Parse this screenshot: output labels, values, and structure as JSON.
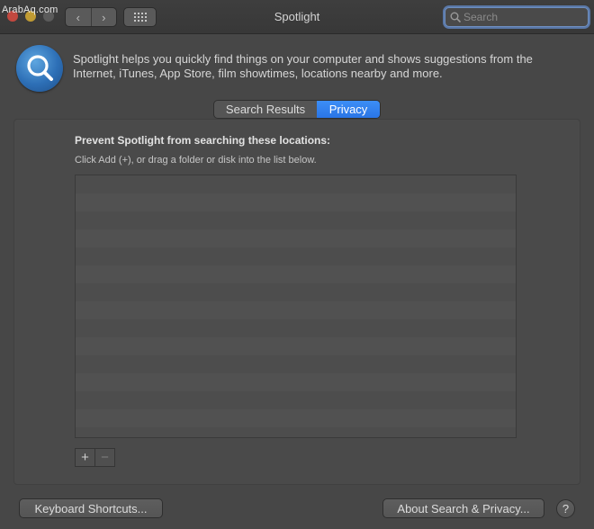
{
  "watermark": "ArabAq.com",
  "window": {
    "title": "Spotlight",
    "search_placeholder": "Search"
  },
  "nav": {
    "back_icon": "chevron-left-icon",
    "forward_icon": "chevron-right-icon",
    "back_glyph": "‹",
    "forward_glyph": "›",
    "grid_icon": "grid-icon"
  },
  "header": {
    "intro_text": "Spotlight helps you quickly find things on your computer and shows suggestions from the Internet, iTunes, App Store, film showtimes, locations nearby and more."
  },
  "tabs": [
    {
      "label": "Search Results",
      "active": false
    },
    {
      "label": "Privacy",
      "active": true
    }
  ],
  "privacy": {
    "heading": "Prevent Spotlight from searching these locations:",
    "instructions": "Click Add (+), or drag a folder or disk into the list below.",
    "items": [],
    "add_label": "+",
    "remove_label": "−"
  },
  "footer": {
    "keyboard_shortcuts_label": "Keyboard Shortcuts...",
    "about_label": "About Search & Privacy...",
    "help_label": "?"
  },
  "colors": {
    "accent": "#2a75e6",
    "window_bg": "#474747",
    "close": "#c2483f",
    "minimize": "#c09b33"
  }
}
